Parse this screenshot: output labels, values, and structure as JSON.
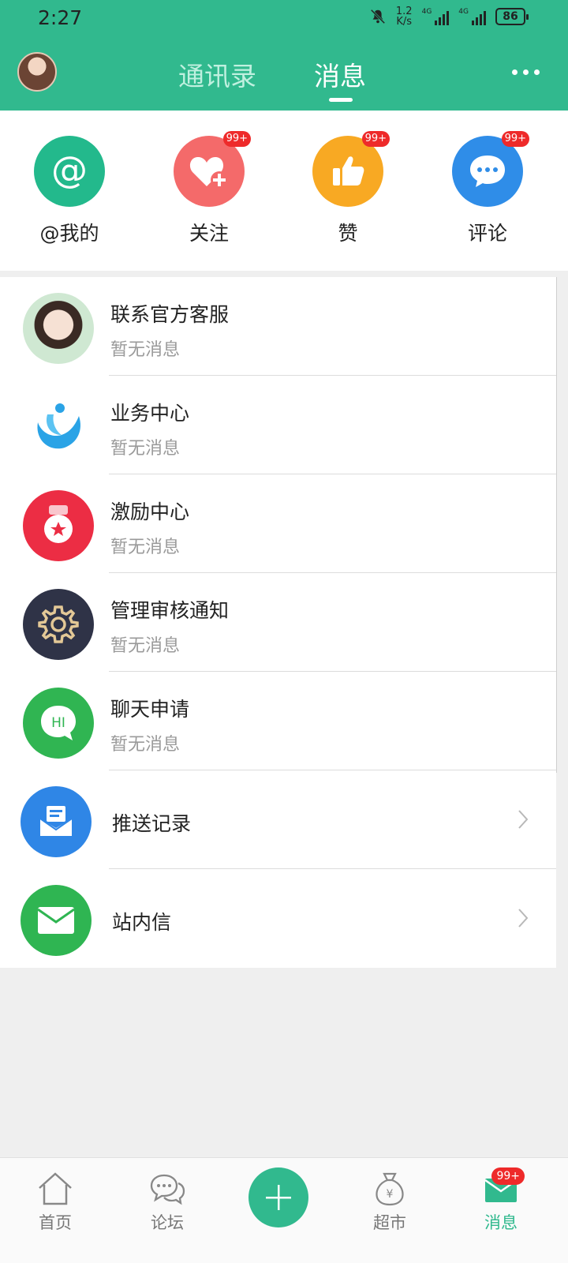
{
  "status_bar": {
    "time": "2:27",
    "speed_value": "1.2",
    "speed_unit": "K/s",
    "sim1": "4G",
    "sim2": "4G",
    "battery": "86"
  },
  "header": {
    "tabs": [
      "通讯录",
      "消息"
    ],
    "active_tab": "消息"
  },
  "categories": [
    {
      "label": "@我的",
      "color": "#23b98c",
      "icon": "at-icon",
      "badge": ""
    },
    {
      "label": "关注",
      "color": "#f46a6a",
      "icon": "heart-plus-icon",
      "badge": "99+"
    },
    {
      "label": "赞",
      "color": "#f8a923",
      "icon": "thumbs-up-icon",
      "badge": "99+"
    },
    {
      "label": "评论",
      "color": "#2f8de8",
      "icon": "comment-icon",
      "badge": "99+"
    }
  ],
  "list": [
    {
      "title": "联系官方客服",
      "subtitle": "暂无消息"
    },
    {
      "title": "业务中心",
      "subtitle": "暂无消息"
    },
    {
      "title": "激励中心",
      "subtitle": "暂无消息"
    },
    {
      "title": "管理审核通知",
      "subtitle": "暂无消息"
    },
    {
      "title": "聊天申请",
      "subtitle": "暂无消息",
      "icon_text": "HI"
    },
    {
      "title": "推送记录"
    },
    {
      "title": "站内信"
    }
  ],
  "bottom_nav": [
    {
      "label": "首页",
      "icon": "home-icon"
    },
    {
      "label": "论坛",
      "icon": "chat-bubble-icon"
    },
    {
      "label": "",
      "icon": "plus-icon"
    },
    {
      "label": "超市",
      "icon": "money-bag-icon"
    },
    {
      "label": "消息",
      "icon": "envelope-icon",
      "badge": "99+",
      "active": true
    }
  ],
  "colors": {
    "accent": "#31b98e",
    "badge": "#ee2a2a"
  }
}
